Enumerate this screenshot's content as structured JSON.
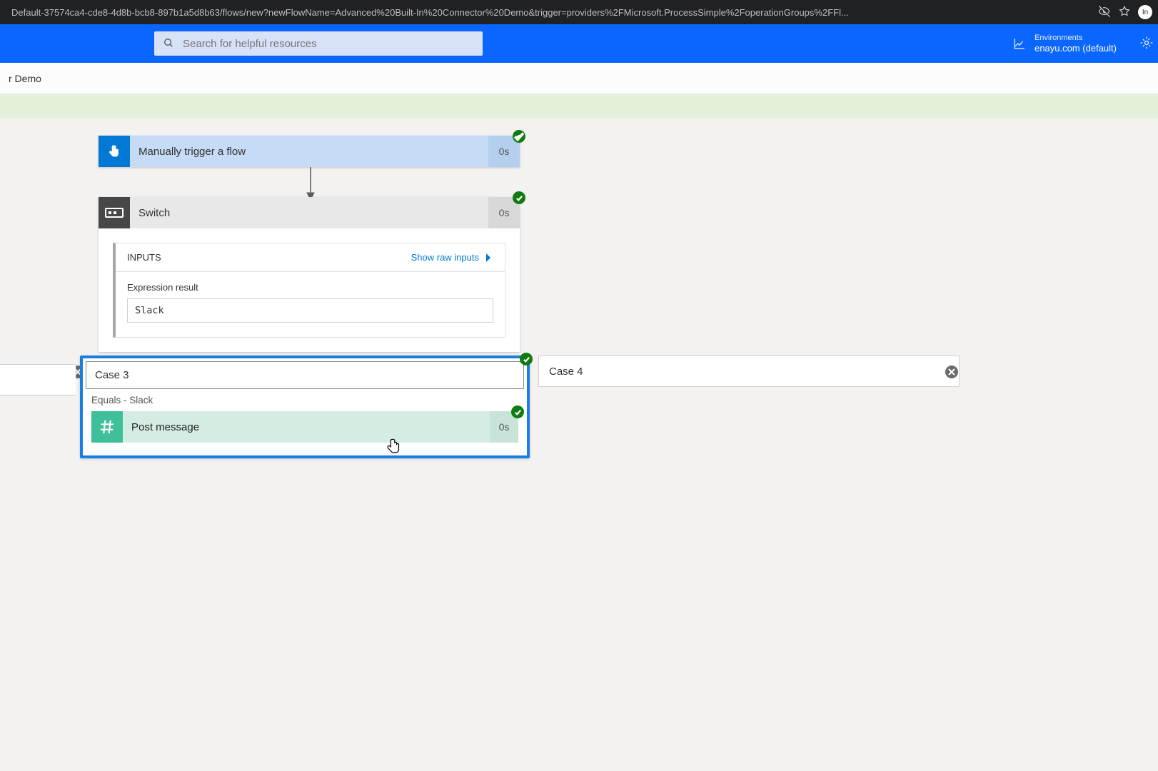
{
  "browser": {
    "url": "Default-37574ca4-cde8-4d8b-bcb8-897b1a5d8b63/flows/new?newFlowName=Advanced%20Built-In%20Connector%20Demo&trigger=providers%2FMicrosoft.ProcessSimple%2FoperationGroups%2FFl...",
    "profile_initial": "In"
  },
  "header": {
    "search_placeholder": "Search for helpful resources",
    "env_label": "Environments",
    "env_value": "enayu.com (default)"
  },
  "crumb": {
    "title": "r Demo"
  },
  "trigger": {
    "title": "Manually trigger a flow",
    "duration": "0s"
  },
  "switch": {
    "title": "Switch",
    "duration": "0s",
    "inputs_label": "INPUTS",
    "show_raw": "Show raw inputs",
    "expr_label": "Expression result",
    "expr_value": "Slack"
  },
  "cases": {
    "active": {
      "title": "Case 3",
      "subtitle": "Equals - Slack",
      "action_title": "Post message",
      "action_duration": "0s"
    },
    "next": {
      "title": "Case 4"
    }
  }
}
